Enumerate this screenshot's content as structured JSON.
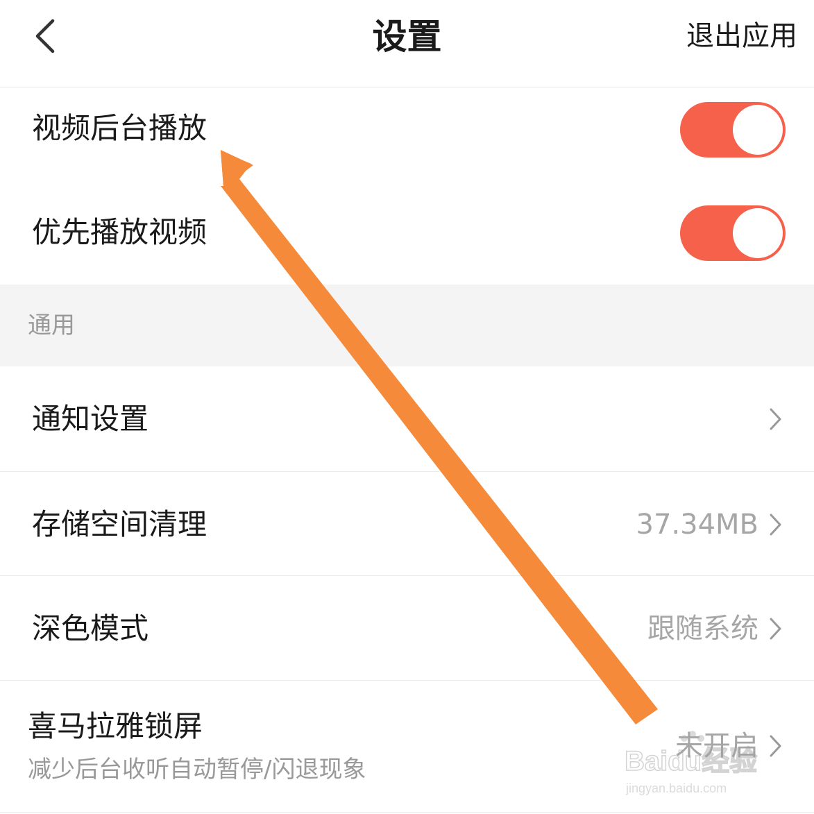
{
  "header": {
    "title": "设置",
    "exit_label": "退出应用"
  },
  "playback": [
    {
      "label": "视频后台播放",
      "enabled": true
    },
    {
      "label": "优先播放视频",
      "enabled": true
    }
  ],
  "general": {
    "section_title": "通用",
    "items": [
      {
        "label": "通知设置",
        "value": ""
      },
      {
        "label": "存储空间清理",
        "value": "37.34MB"
      },
      {
        "label": "深色模式",
        "value": "跟随系统"
      },
      {
        "label": "喜马拉雅锁屏",
        "subtitle": "减少后台收听自动暂停/闪退现象",
        "value": "未开启"
      }
    ]
  },
  "watermark": {
    "brand": "Baidu经验",
    "url": "jingyan.baidu.com"
  },
  "colors": {
    "toggle_on": "#f5614a",
    "annotation_arrow": "#f58b3a",
    "secondary_text": "#999999"
  },
  "icons": {
    "back": "chevron-left-icon",
    "row_chevron": "chevron-right-icon"
  }
}
